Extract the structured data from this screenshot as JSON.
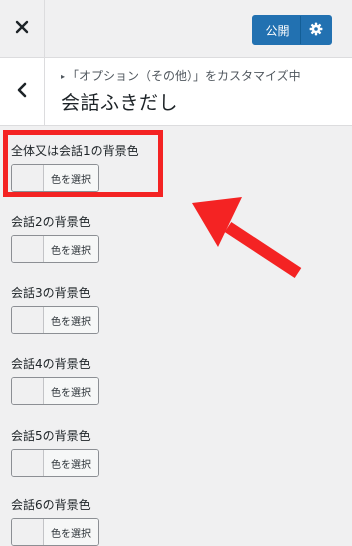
{
  "topbar": {
    "close_icon": "close-icon",
    "publish_label": "公開",
    "settings_icon": "gear-icon",
    "accent_color": "#2271b1"
  },
  "section": {
    "back_icon": "chevron-left-icon",
    "breadcrumb": "「オプション（その他）」をカスタマイズ中",
    "title": "会話ふきだし"
  },
  "controls": [
    {
      "label": "全体又は会話1の背景色",
      "button": "色を選択"
    },
    {
      "label": "会話2の背景色",
      "button": "色を選択"
    },
    {
      "label": "会話3の背景色",
      "button": "色を選択"
    },
    {
      "label": "会話4の背景色",
      "button": "色を選択"
    },
    {
      "label": "会話5の背景色",
      "button": "色を選択"
    },
    {
      "label": "会話6の背景色",
      "button": "色を選択"
    }
  ],
  "annotation": {
    "highlight_color": "#f42323",
    "arrow_color": "#f42323"
  }
}
